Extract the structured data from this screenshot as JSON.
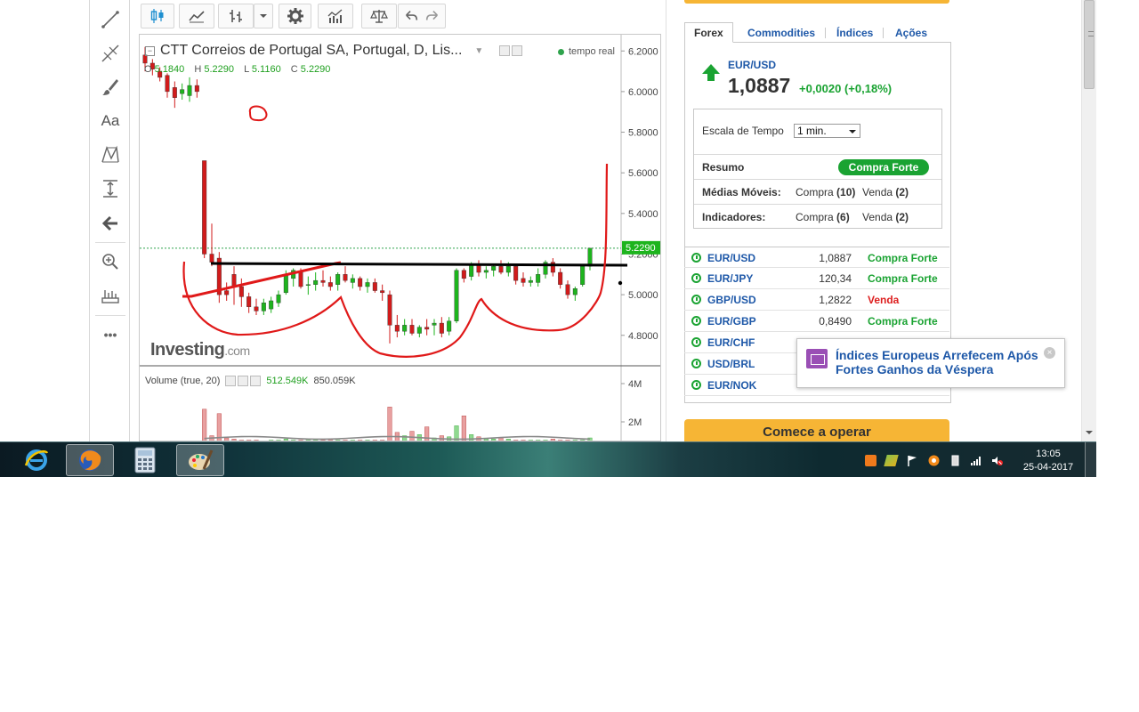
{
  "chart": {
    "title": "CTT Correios de Portugal SA, Portugal, D, Lis...",
    "realtime": "tempo real",
    "ohlc": {
      "o_label": "O",
      "o": "5.1840",
      "h_label": "H",
      "h": "5.2290",
      "l_label": "L",
      "l": "5.1160",
      "c_label": "C",
      "c": "5.2290"
    },
    "price_axis": [
      "6.2000",
      "6.0000",
      "5.8000",
      "5.6000",
      "5.4000",
      "5.2000",
      "5.0000",
      "4.8000"
    ],
    "last_price_tag": "5.2290",
    "volume_axis": [
      "4M",
      "2M"
    ],
    "watermark_brand": "Investing",
    "watermark_suffix": ".com",
    "volume": {
      "label": "Volume (true, 20)",
      "v1": "512.549K",
      "v2": "850.059K"
    }
  },
  "chart_data": {
    "type": "candlestick",
    "ylim": [
      4.65,
      6.28
    ],
    "candles": [
      [
        6.18,
        6.22,
        6.1,
        6.14
      ],
      [
        6.14,
        6.16,
        6.08,
        6.11
      ],
      [
        6.1,
        6.12,
        6.05,
        6.07
      ],
      [
        6.08,
        6.09,
        5.97,
        6.0
      ],
      [
        6.02,
        6.05,
        5.92,
        5.97
      ],
      [
        5.99,
        6.04,
        5.96,
        6.01
      ],
      [
        5.98,
        6.07,
        5.95,
        6.03
      ],
      [
        6.03,
        6.06,
        5.97,
        6.0
      ],
      [
        5.66,
        5.66,
        5.18,
        5.2
      ],
      [
        5.2,
        5.35,
        5.14,
        5.16
      ],
      [
        5.18,
        5.21,
        4.96,
        5.0
      ],
      [
        5.02,
        5.06,
        4.97,
        5.0
      ],
      [
        5.1,
        5.14,
        4.95,
        5.04
      ],
      [
        5.04,
        5.08,
        4.94,
        4.99
      ],
      [
        4.99,
        5.01,
        4.91,
        4.94
      ],
      [
        4.94,
        4.98,
        4.9,
        4.92
      ],
      [
        4.92,
        4.98,
        4.9,
        4.96
      ],
      [
        4.93,
        4.99,
        4.91,
        4.97
      ],
      [
        4.96,
        5.02,
        4.94,
        5.0
      ],
      [
        5.01,
        5.12,
        5.0,
        5.1
      ],
      [
        5.08,
        5.13,
        5.04,
        5.12
      ],
      [
        5.11,
        5.13,
        5.03,
        5.04
      ],
      [
        5.05,
        5.09,
        5.0,
        5.05
      ],
      [
        5.05,
        5.11,
        5.02,
        5.07
      ],
      [
        5.07,
        5.12,
        5.04,
        5.06
      ],
      [
        5.06,
        5.09,
        5.02,
        5.04
      ],
      [
        5.05,
        5.11,
        5.02,
        5.1
      ],
      [
        5.1,
        5.14,
        5.06,
        5.07
      ],
      [
        5.06,
        5.1,
        5.03,
        5.08
      ],
      [
        5.08,
        5.09,
        5.02,
        5.04
      ],
      [
        5.04,
        5.08,
        5.01,
        5.06
      ],
      [
        5.06,
        5.08,
        5.01,
        5.02
      ],
      [
        5.02,
        5.05,
        4.97,
        5.01
      ],
      [
        5.0,
        5.02,
        4.76,
        4.85
      ],
      [
        4.85,
        4.9,
        4.79,
        4.82
      ],
      [
        4.82,
        4.88,
        4.8,
        4.85
      ],
      [
        4.85,
        4.88,
        4.8,
        4.81
      ],
      [
        4.81,
        4.85,
        4.79,
        4.84
      ],
      [
        4.84,
        4.88,
        4.8,
        4.83
      ],
      [
        4.85,
        4.88,
        4.8,
        4.86
      ],
      [
        4.86,
        4.89,
        4.79,
        4.81
      ],
      [
        4.82,
        4.89,
        4.8,
        4.87
      ],
      [
        4.87,
        5.13,
        4.86,
        5.12
      ],
      [
        5.12,
        5.13,
        5.06,
        5.08
      ],
      [
        5.09,
        5.16,
        5.07,
        5.15
      ],
      [
        5.15,
        5.17,
        5.09,
        5.11
      ],
      [
        5.11,
        5.14,
        5.08,
        5.12
      ],
      [
        5.12,
        5.15,
        5.09,
        5.14
      ],
      [
        5.14,
        5.17,
        5.1,
        5.11
      ],
      [
        5.11,
        5.16,
        5.09,
        5.14
      ],
      [
        5.14,
        5.15,
        5.05,
        5.07
      ],
      [
        5.08,
        5.11,
        5.04,
        5.06
      ],
      [
        5.06,
        5.09,
        5.04,
        5.07
      ],
      [
        5.06,
        5.13,
        5.04,
        5.1
      ],
      [
        5.1,
        5.17,
        5.08,
        5.16
      ],
      [
        5.16,
        5.18,
        5.09,
        5.11
      ],
      [
        5.11,
        5.13,
        5.03,
        5.05
      ],
      [
        5.05,
        5.07,
        4.98,
        5.0
      ],
      [
        5.0,
        5.04,
        4.97,
        5.03
      ],
      [
        5.05,
        5.15,
        5.04,
        5.14
      ],
      [
        5.14,
        5.23,
        5.12,
        5.229
      ]
    ],
    "volume_max": 5,
    "volumes": [
      0,
      0,
      0,
      0,
      0,
      0,
      0,
      0,
      3.0,
      0.6,
      2.6,
      0.4,
      0.3,
      0.2,
      0.2,
      0.2,
      0.1,
      0.2,
      0.2,
      0.3,
      0.2,
      0.2,
      0.2,
      0.2,
      0.2,
      0.2,
      0.2,
      0.2,
      0.2,
      0.2,
      0.2,
      0.2,
      0.2,
      3.2,
      0.9,
      0.6,
      1.0,
      0.7,
      1.4,
      0.4,
      0.6,
      0.5,
      1.5,
      2.4,
      0.7,
      0.5,
      0.3,
      0.3,
      0.4,
      0.3,
      0.2,
      0.2,
      0.2,
      0.2,
      0.2,
      0.3,
      0.2,
      0.2,
      0.2,
      0.2,
      0.4
    ]
  },
  "toolbar": {
    "left_tools": [
      "trend-line-icon",
      "fibonacci-icon",
      "brush-icon",
      "text-icon",
      "pattern-icon",
      "measure-icon",
      "back-arrow-icon",
      "zoom-icon",
      "ruler-icon",
      "more-icon"
    ],
    "text_tool_label": "Aa",
    "more_label": "•••"
  },
  "widget": {
    "tabs": [
      "Forex",
      "Commodities",
      "Índices",
      "Ações"
    ],
    "pair": "EUR/USD",
    "price": "1,0887",
    "change": "+0,0020 (+0,18%)",
    "timescale_label": "Escala de Tempo",
    "timescale_value": "1 min.",
    "summary_label": "Resumo",
    "summary_value": "Compra Forte",
    "ma_label": "Médias Móveis:",
    "ma_buy": "Compra",
    "ma_buy_n": "(10)",
    "ma_sell": "Venda",
    "ma_sell_n": "(2)",
    "ind_label": "Indicadores:",
    "ind_buy": "Compra",
    "ind_buy_n": "(6)",
    "ind_sell": "Venda",
    "ind_sell_n": "(2)",
    "rows": [
      {
        "pair": "EUR/USD",
        "value": "1,0887",
        "signal": "Compra Forte",
        "sell": false
      },
      {
        "pair": "EUR/JPY",
        "value": "120,34",
        "signal": "Compra Forte",
        "sell": false
      },
      {
        "pair": "GBP/USD",
        "value": "1,2822",
        "signal": "Venda",
        "sell": true
      },
      {
        "pair": "EUR/GBP",
        "value": "0,8490",
        "signal": "Compra Forte",
        "sell": false
      },
      {
        "pair": "EUR/CHF",
        "value": "",
        "signal": "",
        "sell": false
      },
      {
        "pair": "USD/BRL",
        "value": "",
        "signal": "",
        "sell": false
      },
      {
        "pair": "EUR/NOK",
        "value": "",
        "signal": "",
        "sell": false
      }
    ],
    "cta": "Comece a operar"
  },
  "news": {
    "headline": "Índices Europeus Arrefecem Após Fortes Ganhos da Véspera"
  },
  "taskbar": {
    "time": "13:05",
    "date": "25-04-2017"
  },
  "colors": {
    "up": "#1db41d",
    "down": "#d11b1b",
    "accent_orange": "#f6b535",
    "link_blue": "#1e58a8"
  }
}
